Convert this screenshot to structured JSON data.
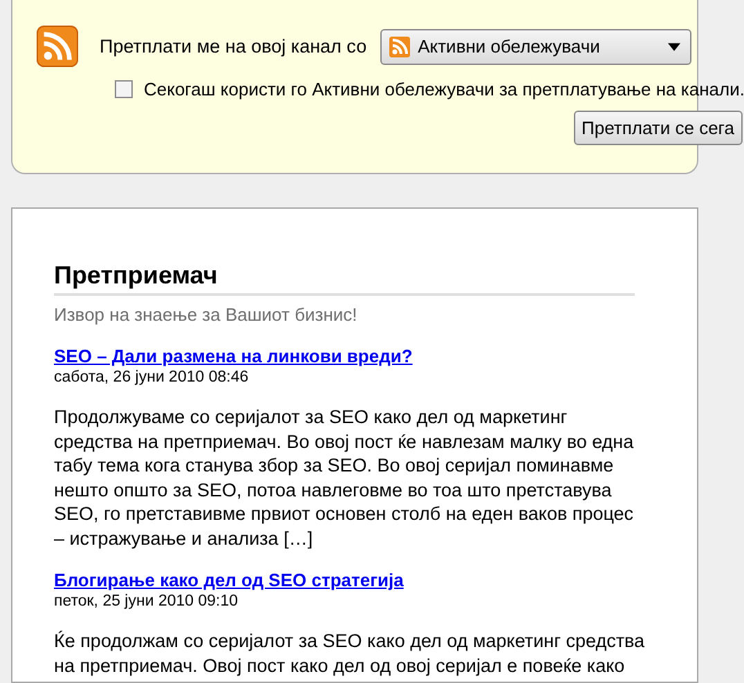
{
  "subscribe": {
    "label": "Претплати ме на овој канал со",
    "reader": "Активни обележувачи",
    "always_use": {
      "label": "Секогаш користи го Активни обележувачи за претплатување на канали.",
      "checked": false
    },
    "button": "Претплати се сега"
  },
  "blog": {
    "title": "Претприемач",
    "subtitle": "Извор на знаење за Вашиот бизнис!",
    "posts": [
      {
        "title": "SEO – Дали размена на линкови вреди?",
        "date": "сабота, 26 јуни 2010 08:46",
        "summary": "Продолжуваме со серијалот за SEO како дел од маркетинг средства на претприемач. Во овој пост ќе навлезам малку во една табу тема кога станува збор за SEO. Во овој серијал поминавме нешто општо за SEO, потоа навлеговме во тоа што претставува SEO, го претставивме првиот основен столб на еден ваков процес – истражување и анализа […]"
      },
      {
        "title": "Блогирање како дел од SEO стратегија",
        "date": "петок, 25 јуни 2010 09:10",
        "summary": "Ќе продолжам со серијалот за SEO како дел од маркетинг средства на претприемач. Овој пост како дел од овој серијал е повеќе како"
      }
    ]
  }
}
